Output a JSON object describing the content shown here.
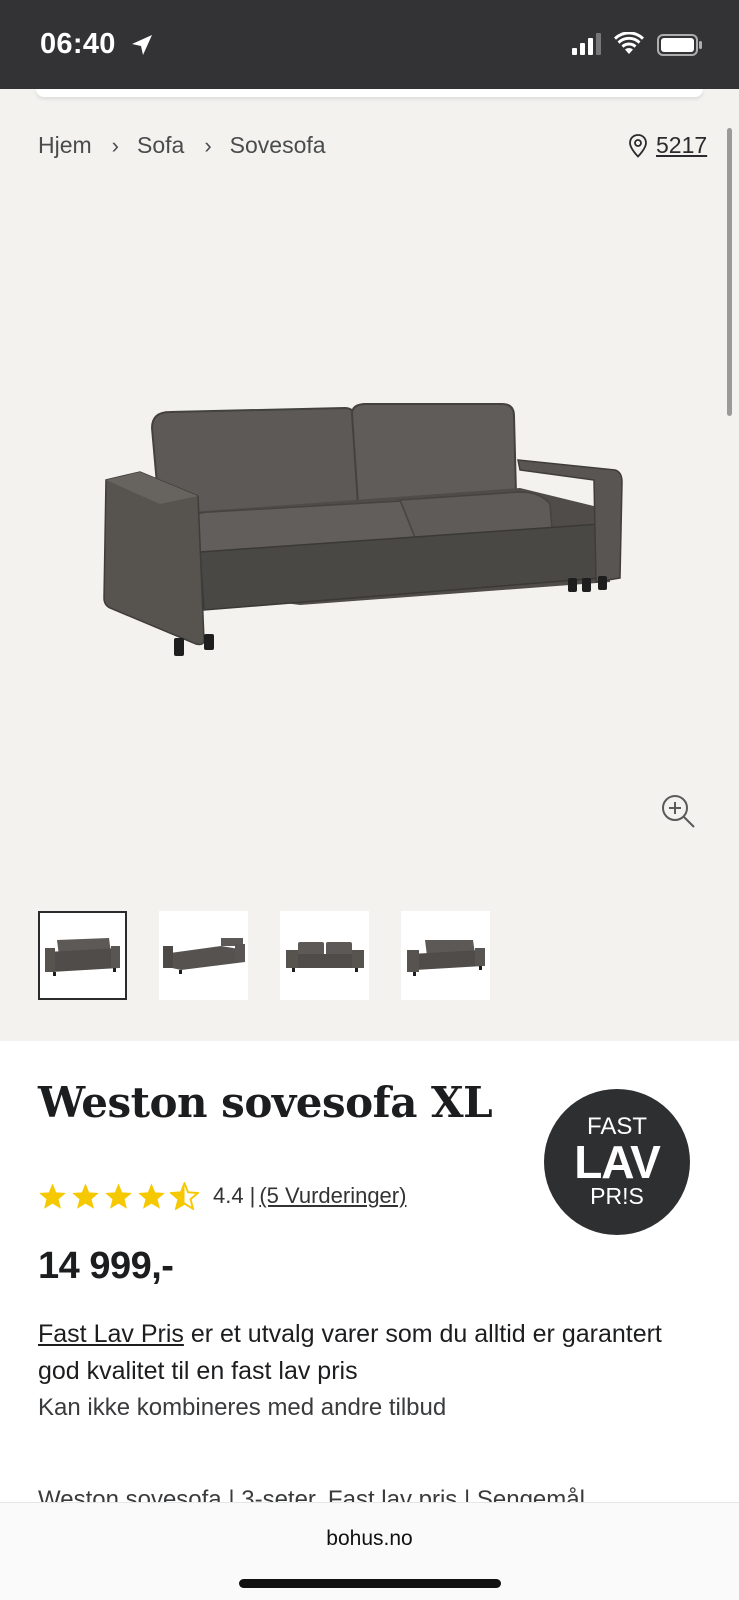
{
  "status": {
    "time": "06:40"
  },
  "breadcrumb": {
    "items": [
      "Hjem",
      "Sofa",
      "Sovesofa"
    ]
  },
  "store": {
    "code": "5217"
  },
  "product": {
    "title": "Weston sovesofa XL",
    "rating_value": "4.4",
    "rating_count_label": "(5 Vurderinger)",
    "rating_stars": 4.4,
    "price": "14 999,-",
    "promo_link": "Fast Lav Pris",
    "promo_text": " er et utvalg varer som du alltid er garantert god kvalitet til en fast lav pris",
    "promo_sub": "Kan ikke kombineres med andre tilbud",
    "cutoff_text": "Weston sovesofa | 3-seter, Fast lav pris | Sengemål"
  },
  "badge": {
    "line1": "FAST",
    "line2": "LAV",
    "line3": "PR!S"
  },
  "colors": {
    "statusbar": "#333336",
    "gallery_bg": "#f4f2ef",
    "star": "#f5c800",
    "sofa": "#5b5855"
  },
  "browser": {
    "url": "bohus.no"
  }
}
